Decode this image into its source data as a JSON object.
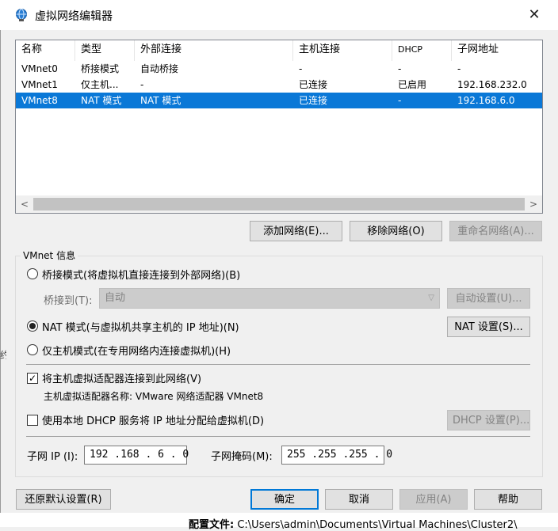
{
  "window": {
    "title": "虚拟网络编辑器",
    "close_glyph": "✕",
    "icon": "network-globe-icon"
  },
  "network_table": {
    "columns": [
      "名称",
      "类型",
      "外部连接",
      "主机连接",
      "DHCP",
      "子网地址"
    ],
    "rows": [
      {
        "name": "VMnet0",
        "type": "桥接模式",
        "external": "自动桥接",
        "host": "-",
        "dhcp": "-",
        "subnet": "-"
      },
      {
        "name": "VMnet1",
        "type": "仅主机...",
        "external": "-",
        "host": "已连接",
        "dhcp": "已启用",
        "subnet": "192.168.232.0"
      },
      {
        "name": "VMnet8",
        "type": "NAT 模式",
        "external": "NAT 模式",
        "host": "已连接",
        "dhcp": "-",
        "subnet": "192.168.6.0"
      }
    ],
    "selected_index": 2,
    "scroll_left": "<",
    "scroll_right": ">"
  },
  "list_buttons": {
    "add": "添加网络(E)...",
    "remove": "移除网络(O)",
    "rename": "重命名网络(A)..."
  },
  "vmnet_info": {
    "group_label": "VMnet 信息",
    "bridged_label": "桥接模式(将虚拟机直接连接到外部网络)(B)",
    "bridge_to_label": "桥接到(T):",
    "bridge_to_value": "自动",
    "auto_settings": "自动设置(U)...",
    "nat_label": "NAT 模式(与虚拟机共享主机的 IP 地址)(N)",
    "nat_settings": "NAT 设置(S)...",
    "hostonly_label": "仅主机模式(在专用网络内连接虚拟机)(H)",
    "connect_adapter_label": "将主机虚拟适配器连接到此网络(V)",
    "connect_adapter_checked": true,
    "adapter_name_label": "主机虚拟适配器名称: VMware 网络适配器 VMnet8",
    "dhcp_label": "使用本地 DHCP 服务将 IP 地址分配给虚拟机(D)",
    "dhcp_checked": false,
    "dhcp_settings": "DHCP 设置(P)...",
    "subnet_ip_label": "子网 IP (I):",
    "subnet_ip_value": "192 .168 . 6  . 0",
    "subnet_mask_label": "子网掩码(M):",
    "subnet_mask_value": "255 .255 .255 . 0",
    "selected_mode": "nat"
  },
  "footer": {
    "restore": "还原默认设置(R)",
    "ok": "确定",
    "cancel": "取消",
    "apply": "应用(A)",
    "help": "帮助",
    "config_label": "配置文件:",
    "config_path": "C:\\Users\\admin\\Documents\\Virtual Machines\\Cluster2\\"
  },
  "colors": {
    "selection": "#0a78d7",
    "primary_border": "#0078d7"
  }
}
